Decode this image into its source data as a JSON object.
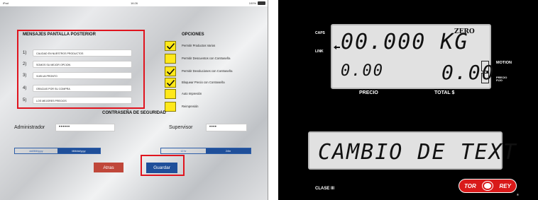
{
  "status_bar": {
    "left": "iPad",
    "time": "16:26",
    "battery": "100%"
  },
  "messages": {
    "title": "MENSAJES PANTALLA POSTERIOR",
    "items": [
      {
        "num": "1)",
        "text": "CALIDAD EN NUESTROS PRODUCTOS"
      },
      {
        "num": "2)",
        "text": "SOMOS SU MEJOR OPCION"
      },
      {
        "num": "3)",
        "text": "VUELVA PRONTO"
      },
      {
        "num": "4)",
        "text": "GRACIAS POR SU COMPRA"
      },
      {
        "num": "5)",
        "text": "LOS MEJORES PRECIOS"
      }
    ]
  },
  "options": {
    "title": "OPCIONES",
    "items": [
      {
        "label": "Permitir Productos Varios",
        "checked": true
      },
      {
        "label": "Permitir Descuentos con Contraseña",
        "checked": false
      },
      {
        "label": "Permitir Devoluciones con Contraseña",
        "checked": true
      },
      {
        "label": "Bloquear Precio con Contraseña",
        "checked": true
      },
      {
        "label": "Auto Impresión",
        "checked": false
      },
      {
        "label": "Reimpresión",
        "checked": false
      }
    ]
  },
  "security": {
    "title": "CONTRASEÑA DE SEGURIDAD",
    "admin_label": "Administrador",
    "admin_value": "••••••",
    "supervisor_label": "Supervisor",
    "supervisor_value": "••••"
  },
  "date_format": {
    "options": [
      "dd/MM/yyyy",
      "MM/dd/yyyy"
    ],
    "selected": "MM/dd/yyyy"
  },
  "time_format": {
    "options": [
      "12 hr",
      "24hr"
    ],
    "selected": "24hr"
  },
  "buttons": {
    "back": "Atras",
    "save": "Guardar"
  },
  "scale_display": {
    "weight": "00.000 KG",
    "zero": "ZERO",
    "price": "0.00",
    "total": "0.00",
    "message": "CAMBIO DE TEXT",
    "caps": "CAPS",
    "link": "LINK",
    "motion": "MOTION",
    "precio_fijo": [
      "PRECIO",
      "FIJO"
    ],
    "precio_label": "PRECIO",
    "total_label": "TOTAL $",
    "class_label": "CLASE III",
    "logo_left": "TOR",
    "logo_right": "REY",
    "registered": "®"
  },
  "colors": {
    "highlight": "#e0141e",
    "checkbox": "#ffe81a",
    "primary": "#1f4f9a",
    "danger": "#c0473a"
  }
}
